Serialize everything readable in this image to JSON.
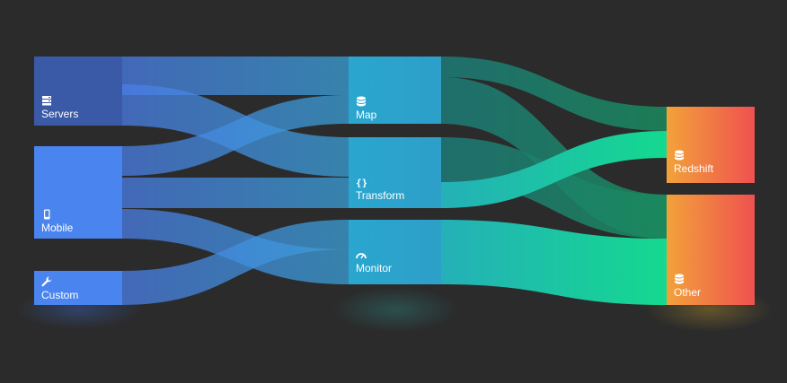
{
  "colors": {
    "background": "#2b2b2b",
    "source_blue": "#4a84ef",
    "source_dark": "#3a5aa8",
    "mid_teal": "#2aa6cf",
    "flow_green": "#14d98f",
    "sink_orange": "#f2a23a",
    "sink_red": "#ef5150"
  },
  "diagram": {
    "columns": [
      "sources",
      "processes",
      "destinations"
    ],
    "nodes": [
      {
        "id": "servers",
        "label": "Servers",
        "icon": "server-icon"
      },
      {
        "id": "mobile",
        "label": "Mobile",
        "icon": "mobile-icon"
      },
      {
        "id": "custom",
        "label": "Custom",
        "icon": "wrench-icon"
      },
      {
        "id": "map",
        "label": "Map",
        "icon": "database-icon"
      },
      {
        "id": "transform",
        "label": "Transform",
        "icon": "braces-icon"
      },
      {
        "id": "monitor",
        "label": "Monitor",
        "icon": "gauge-icon"
      },
      {
        "id": "redshift",
        "label": "Redshift",
        "icon": "database-icon"
      },
      {
        "id": "other",
        "label": "Other",
        "icon": "database-icon"
      }
    ]
  }
}
